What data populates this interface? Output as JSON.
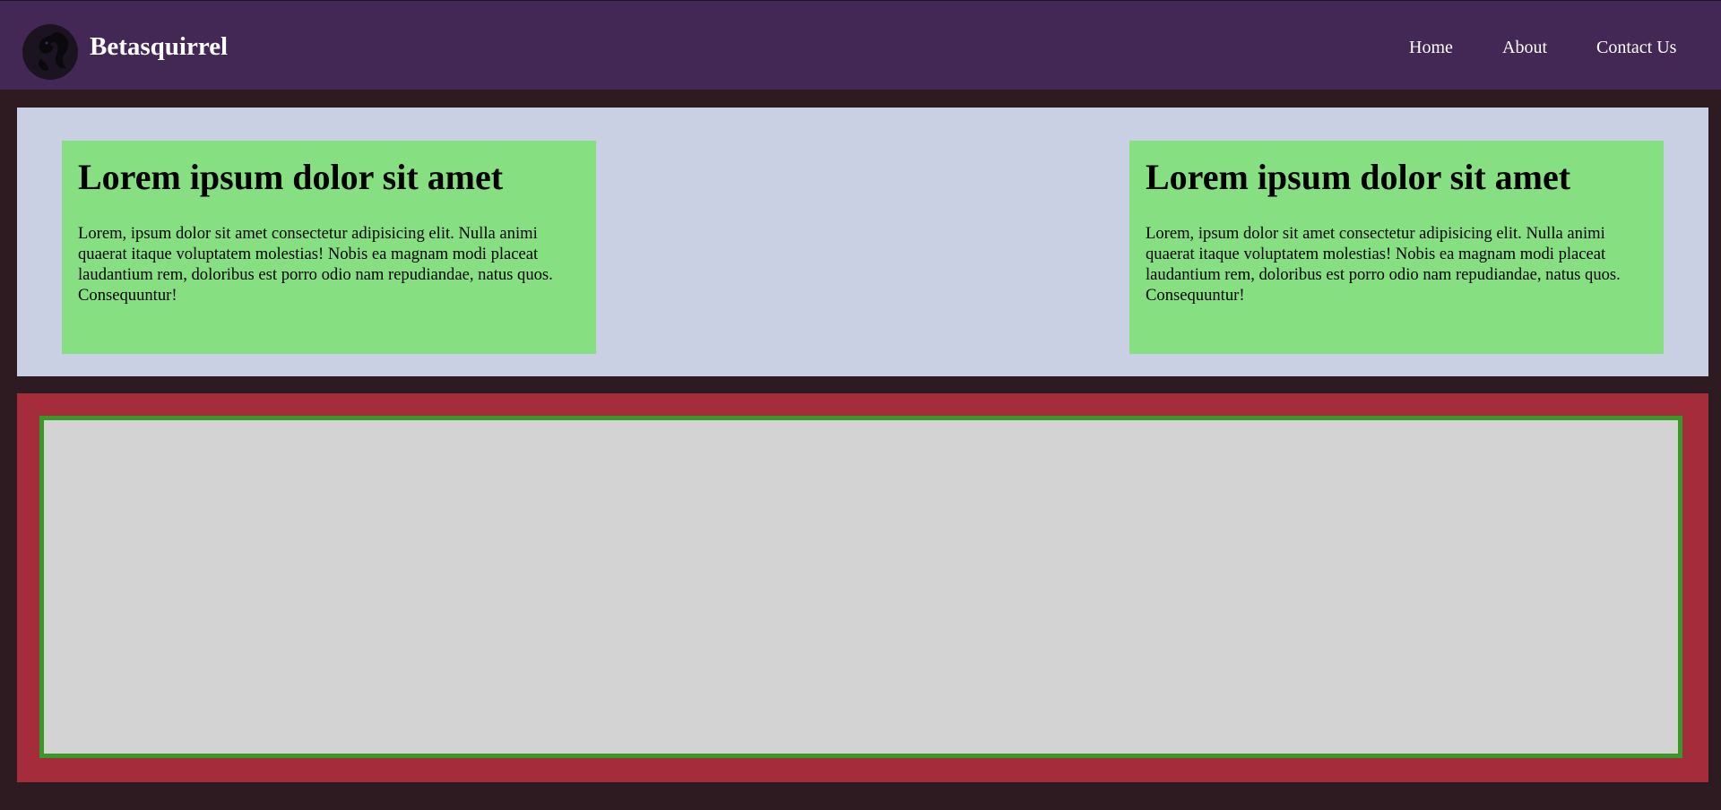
{
  "header": {
    "brand": "Betasquirrel",
    "logo_icon": "squirrel-logo-icon",
    "nav": [
      {
        "label": "Home"
      },
      {
        "label": "About"
      },
      {
        "label": "Contact Us"
      }
    ]
  },
  "hero": {
    "cards": [
      {
        "title": "Lorem ipsum dolor sit amet",
        "body": "Lorem, ipsum dolor sit amet consectetur adipisicing elit. Nulla animi quaerat itaque voluptatem molestias! Nobis ea magnam modi placeat laudantium rem, doloribus est porro odio nam repudiandae, natus quos. Consequuntur!"
      },
      {
        "title": "Lorem ipsum dolor sit amet",
        "body": "Lorem, ipsum dolor sit amet consectetur adipisicing elit. Nulla animi quaerat itaque voluptatem molestias! Nobis ea magnam modi placeat laudantium rem, doloribus est porro odio nam repudiandae, natus quos. Consequuntur!"
      }
    ]
  },
  "colors": {
    "page_background": "#2e1b22",
    "navbar": "#432856",
    "hero_background": "#cad0e3",
    "card": "#86df81",
    "lower_section": "#a52d3b",
    "lower_box": "#d3d3d3",
    "lower_box_border": "#379a26"
  }
}
